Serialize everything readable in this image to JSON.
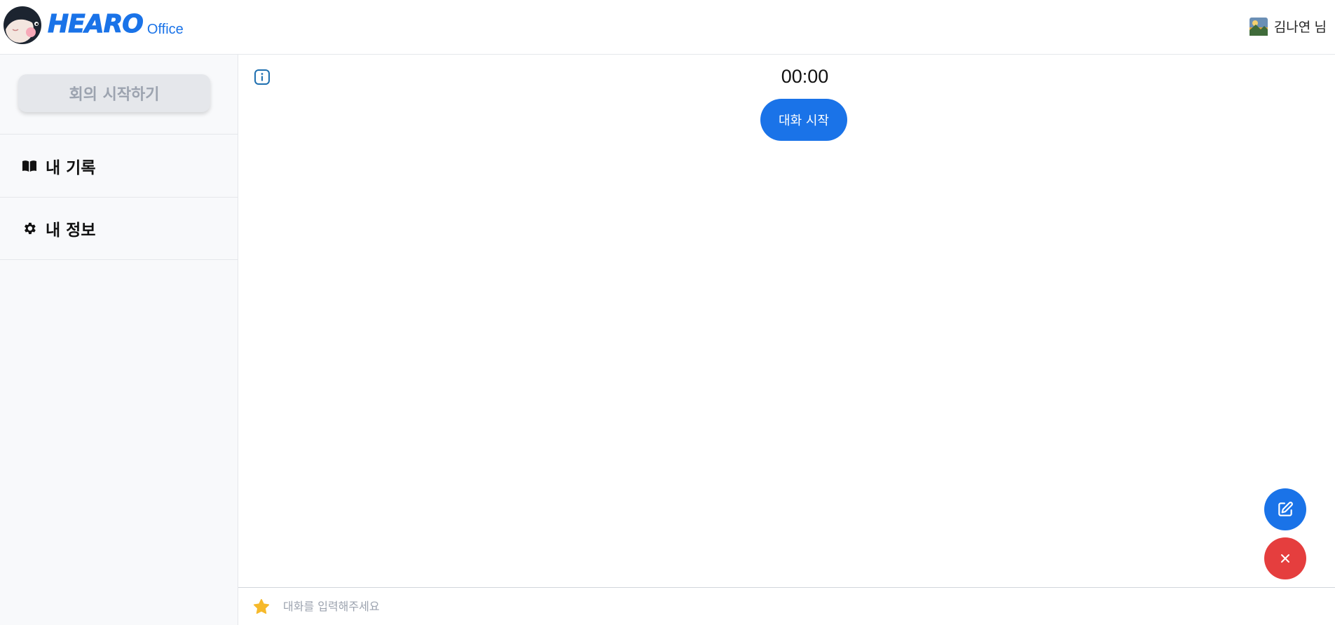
{
  "header": {
    "logo_text": "HEARO",
    "logo_sub": "Office",
    "user_name": "김나연 님"
  },
  "sidebar": {
    "start_meeting_label": "회의 시작하기",
    "items": [
      {
        "label": "내 기록",
        "icon": "book-icon"
      },
      {
        "label": "내 정보",
        "icon": "gear-icon"
      }
    ]
  },
  "main": {
    "timer": "00:00",
    "chat_start_label": "대화 시작"
  },
  "input": {
    "placeholder": "대화를 입력해주세요",
    "value": ""
  },
  "colors": {
    "accent": "#1a73e8",
    "danger": "#e53e3e",
    "star": "#f6b92b",
    "sidebar_bg": "#f8f9fb"
  }
}
